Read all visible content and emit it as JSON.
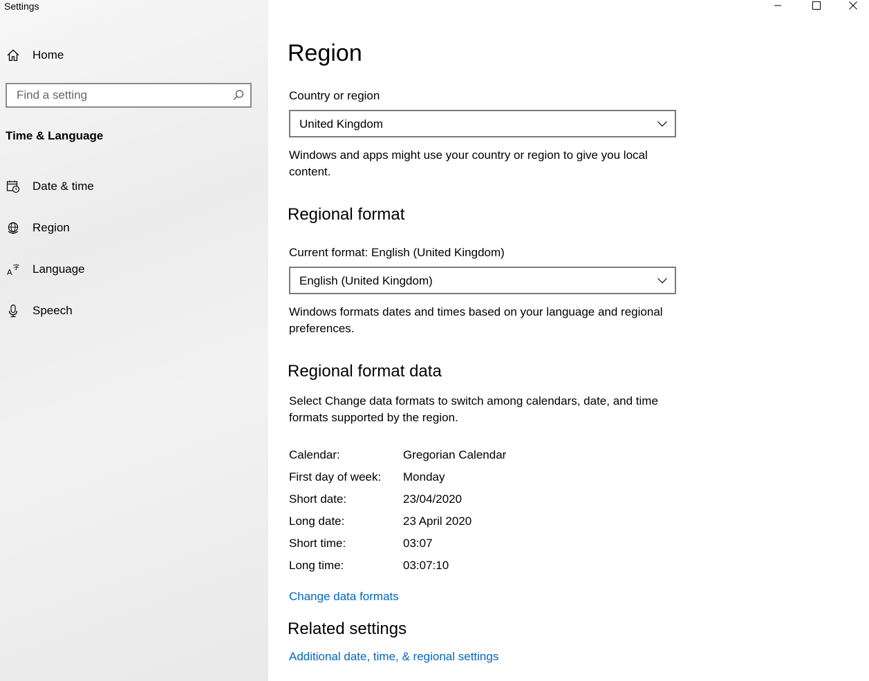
{
  "window": {
    "title": "Settings",
    "controls": {
      "minimize": "minimize",
      "maximize": "maximize",
      "close": "close"
    }
  },
  "sidebar": {
    "home_label": "Home",
    "search_placeholder": "Find a setting",
    "section_heading": "Time & Language",
    "items": [
      {
        "label": "Date & time",
        "icon": "calendar-clock-icon"
      },
      {
        "label": "Region",
        "icon": "globe-icon"
      },
      {
        "label": "Language",
        "icon": "language-icon"
      },
      {
        "label": "Speech",
        "icon": "microphone-icon"
      }
    ]
  },
  "main": {
    "page_title": "Region",
    "country": {
      "label": "Country or region",
      "selected": "United Kingdom",
      "description": "Windows and apps might use your country or region to give you local content."
    },
    "regional_format": {
      "heading": "Regional format",
      "current_label": "Current format: English (United Kingdom)",
      "selected": "English (United Kingdom)",
      "description": "Windows formats dates and times based on your language and regional preferences."
    },
    "format_data": {
      "heading": "Regional format data",
      "description": "Select Change data formats to switch among calendars, date, and time formats supported by the region.",
      "rows": [
        {
          "key": "Calendar:",
          "value": "Gregorian Calendar"
        },
        {
          "key": "First day of week:",
          "value": "Monday"
        },
        {
          "key": "Short date:",
          "value": "23/04/2020"
        },
        {
          "key": "Long date:",
          "value": "23 April 2020"
        },
        {
          "key": "Short time:",
          "value": "03:07"
        },
        {
          "key": "Long time:",
          "value": "03:07:10"
        }
      ],
      "change_link": "Change data formats"
    },
    "related": {
      "heading": "Related settings",
      "link": "Additional date, time, & regional settings"
    }
  },
  "colors": {
    "accent": "#0067c0",
    "sidebar_bg": "#efefef",
    "border": "#7a7a7a"
  }
}
